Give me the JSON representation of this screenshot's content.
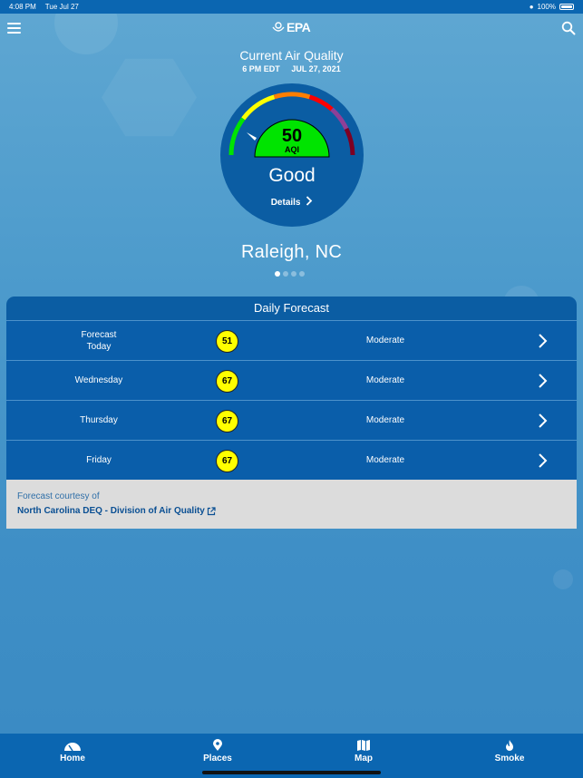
{
  "status_bar": {
    "time": "4:08 PM",
    "date": "Tue Jul 27",
    "battery": "100%"
  },
  "header": {
    "logo": "EPA"
  },
  "current": {
    "title": "Current Air Quality",
    "time": "6 PM EDT",
    "date": "JUL 27, 2021",
    "aqi_value": "50",
    "aqi_label": "AQI",
    "category": "Good",
    "details_label": "Details",
    "aqi_color": "#00e400"
  },
  "location": {
    "city": "Raleigh, NC",
    "page_count": 4,
    "active_page": 1
  },
  "forecast": {
    "title": "Daily Forecast",
    "rows": [
      {
        "day": "Forecast\nToday",
        "aqi": "51",
        "category": "Moderate",
        "color": "#ffff00"
      },
      {
        "day": "Wednesday",
        "aqi": "67",
        "category": "Moderate",
        "color": "#ffff00"
      },
      {
        "day": "Thursday",
        "aqi": "67",
        "category": "Moderate",
        "color": "#ffff00"
      },
      {
        "day": "Friday",
        "aqi": "67",
        "category": "Moderate",
        "color": "#ffff00"
      }
    ],
    "courtesy_label": "Forecast courtesy of",
    "courtesy_source": "North Carolina DEQ - Division of Air Quality"
  },
  "tabs": [
    {
      "label": "Home",
      "icon": "gauge-icon"
    },
    {
      "label": "Places",
      "icon": "map-pin-icon"
    },
    {
      "label": "Map",
      "icon": "map-icon"
    },
    {
      "label": "Smoke",
      "icon": "fire-icon"
    }
  ],
  "colors": {
    "brand_blue": "#0b66b1",
    "good": "#00e400",
    "moderate": "#ffff00"
  }
}
